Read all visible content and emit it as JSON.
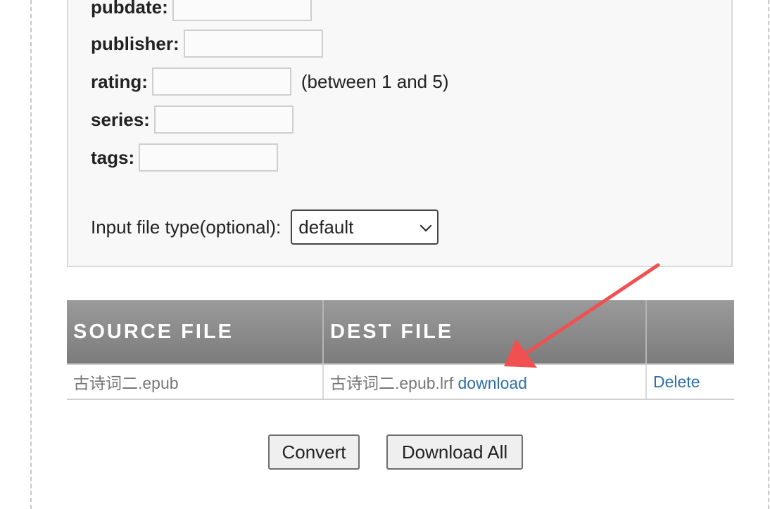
{
  "form": {
    "fields": [
      {
        "label": "pubdate:",
        "value": ""
      },
      {
        "label": "publisher:",
        "value": ""
      },
      {
        "label": "rating:",
        "value": "",
        "hint": "(between 1 and 5)"
      },
      {
        "label": "series:",
        "value": ""
      },
      {
        "label": "tags:",
        "value": ""
      }
    ],
    "input_type_label": "Input file type(optional):",
    "input_type_selected": "default"
  },
  "table": {
    "headers": [
      "SOURCE FILE",
      "DEST FILE",
      ""
    ],
    "rows": [
      {
        "source": "古诗词二.epub",
        "dest": "古诗词二.epub.lrf",
        "download_label": "download",
        "delete_label": "Delete"
      }
    ]
  },
  "buttons": {
    "convert": "Convert",
    "download_all": "Download All"
  },
  "colors": {
    "annotation_arrow": "#f05050",
    "link": "#2f6fa8",
    "header_bg": "#8a8a8a"
  }
}
